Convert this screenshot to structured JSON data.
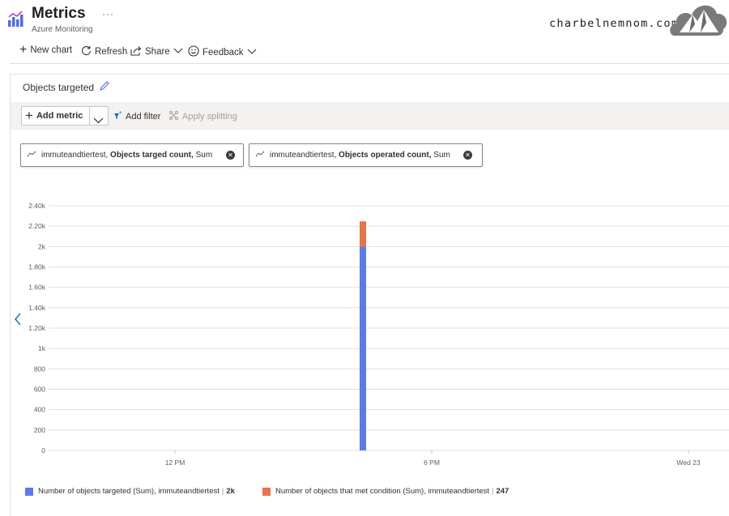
{
  "header": {
    "title": "Metrics",
    "subtitle": "Azure Monitoring",
    "more": "···",
    "watermark": "charbelnemnom.com"
  },
  "toolbar": {
    "new_chart": "New chart",
    "refresh": "Refresh",
    "share": "Share",
    "feedback": "Feedback"
  },
  "chart_panel": {
    "title": "Objects targeted",
    "add_metric": "Add metric",
    "add_filter": "Add filter",
    "apply_splitting": "Apply splitting",
    "pills": [
      {
        "resource": "immuteandtiertest,",
        "metric": "Objects targed count,",
        "agg": "Sum"
      },
      {
        "resource": "immuteandtiertest,",
        "metric": "Objects operated count,",
        "agg": "Sum"
      }
    ]
  },
  "chart_data": {
    "type": "bar",
    "stacked": true,
    "y_ticks": [
      "0",
      "200",
      "400",
      "600",
      "800",
      "1k",
      "1.20k",
      "1.40k",
      "1.60k",
      "1.80k",
      "2k",
      "2.20k",
      "2.40k"
    ],
    "ylim": [
      0,
      2400
    ],
    "x_ticks": [
      "12 PM",
      "6 PM",
      "Wed 23"
    ],
    "grid": true,
    "series": [
      {
        "name": "Number of objects targeted (Sum), immuteandtiertest",
        "value_label": "2k",
        "values": [
          2000
        ],
        "color": "#5b7be8"
      },
      {
        "name": "Number of objects that met condition (Sum), immuteandtiertest",
        "value_label": "247",
        "values": [
          247
        ],
        "color": "#e8734a"
      }
    ]
  }
}
